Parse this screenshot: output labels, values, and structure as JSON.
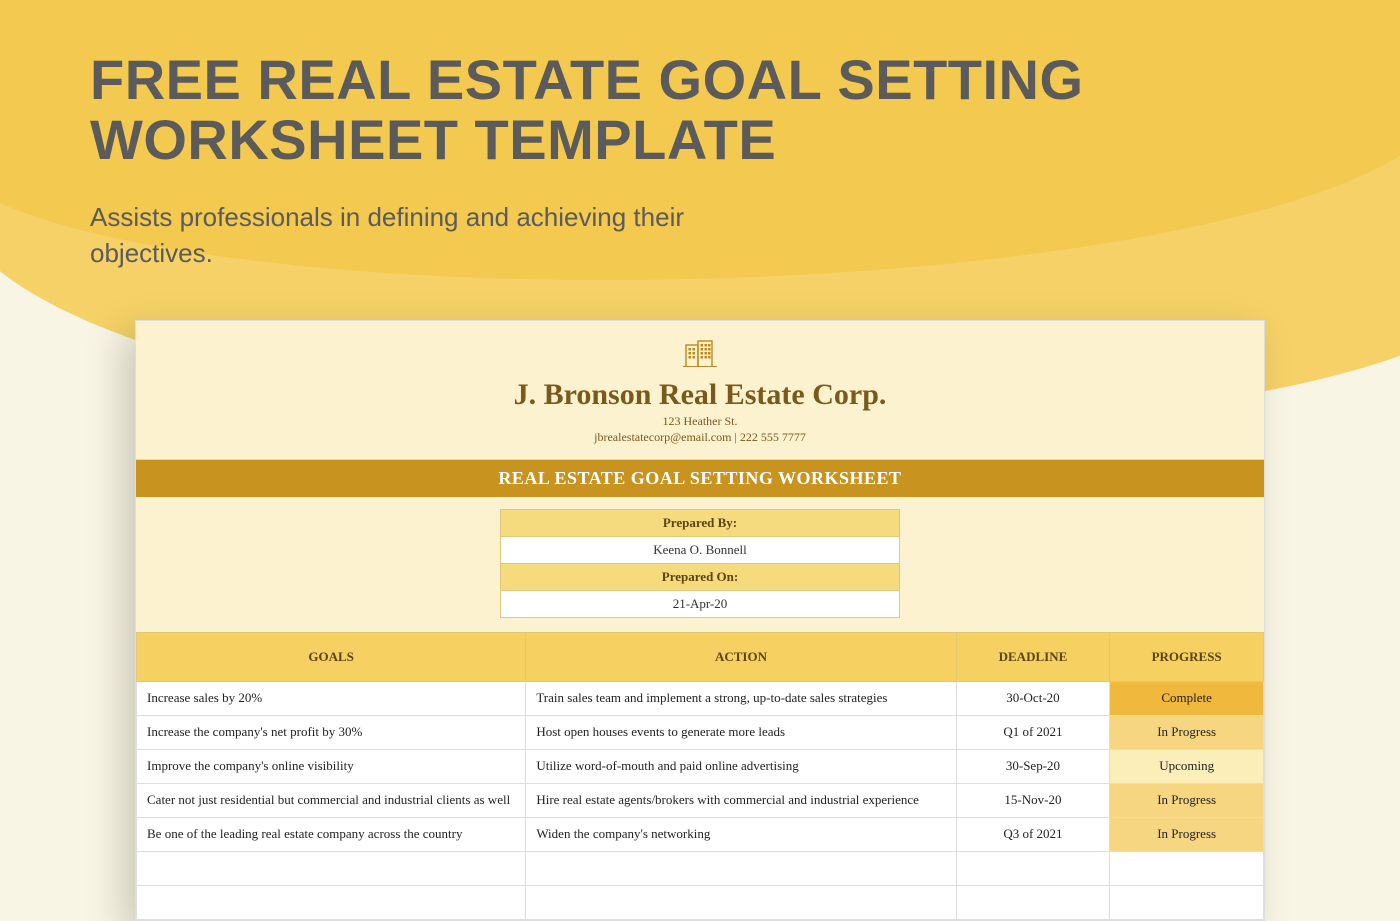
{
  "hero": {
    "title": "FREE REAL ESTATE GOAL SETTING WORKSHEET TEMPLATE",
    "subtitle": "Assists professionals in defining and achieving their objectives."
  },
  "letterhead": {
    "company": "J. Bronson Real Estate Corp.",
    "address": "123 Heather St.",
    "contact": "jbrealestatecorp@email.com | 222 555 7777"
  },
  "titlebar": "REAL ESTATE GOAL SETTING WORKSHEET",
  "meta": {
    "prepared_by_label": "Prepared By:",
    "prepared_by_value": "Keena O. Bonnell",
    "prepared_on_label": "Prepared On:",
    "prepared_on_value": "21-Apr-20"
  },
  "columns": {
    "goals": "GOALS",
    "action": "ACTION",
    "deadline": "DEADLINE",
    "progress": "PROGRESS"
  },
  "rows": [
    {
      "goal": "Increase sales by 20%",
      "action": "Train sales team and implement a strong, up-to-date sales strategies",
      "deadline": "30-Oct-20",
      "progress": "Complete",
      "pclass": "p-complete"
    },
    {
      "goal": "Increase the company's net profit by 30%",
      "action": "Host open houses events to generate more leads",
      "deadline": "Q1 of 2021",
      "progress": "In Progress",
      "pclass": "p-inprogress"
    },
    {
      "goal": "Improve the company's online visibility",
      "action": "Utilize word-of-mouth and paid online advertising",
      "deadline": "30-Sep-20",
      "progress": "Upcoming",
      "pclass": "p-upcoming"
    },
    {
      "goal": "Cater not just residential but commercial and industrial clients as well",
      "action": "Hire real estate agents/brokers with commercial and industrial experience",
      "deadline": "15-Nov-20",
      "progress": "In Progress",
      "pclass": "p-inprogress"
    },
    {
      "goal": "Be one of the leading real estate company across the country",
      "action": "Widen the company's networking",
      "deadline": "Q3 of 2021",
      "progress": "In Progress",
      "pclass": "p-inprogress"
    },
    {
      "goal": "",
      "action": "",
      "deadline": "",
      "progress": "",
      "pclass": ""
    },
    {
      "goal": "",
      "action": "",
      "deadline": "",
      "progress": "",
      "pclass": ""
    }
  ]
}
